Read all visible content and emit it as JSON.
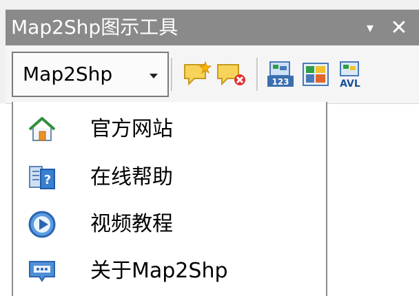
{
  "window": {
    "title": "Map2Shp图示工具",
    "pin_glyph": "▾",
    "close_glyph": "✕"
  },
  "toolbar": {
    "menu_button_label": "Map2Shp",
    "icons": [
      "add-note-icon",
      "delete-note-icon",
      "number-label-icon",
      "map-grid-icon",
      "text-label-icon"
    ]
  },
  "menu": {
    "items": [
      {
        "label": "官方网站",
        "icon": "home-icon"
      },
      {
        "label": "在线帮助",
        "icon": "help-book-icon"
      },
      {
        "label": "视频教程",
        "icon": "play-video-icon"
      },
      {
        "label": "关于Map2Shp",
        "icon": "about-chat-icon"
      }
    ]
  },
  "colors": {
    "titlebar": "#8a8a8a",
    "menu_border": "#8c8c8c",
    "accent_blue": "#3a7fd0"
  }
}
